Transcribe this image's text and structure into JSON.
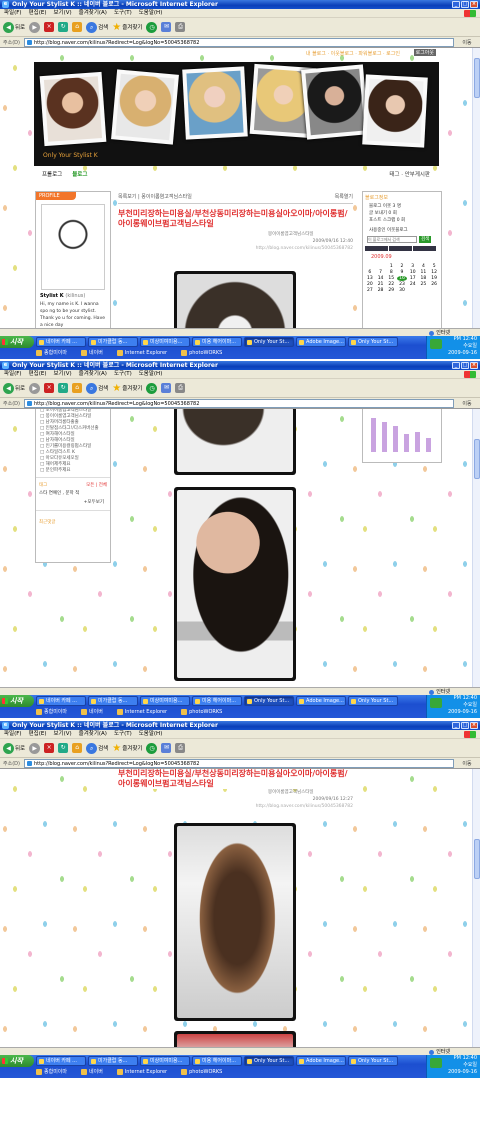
{
  "window": {
    "title": "Only Your Stylist K :: 네이버 블로그 - Microsoft Internet Explorer",
    "menu": [
      "파일(F)",
      "편집(E)",
      "보기(V)",
      "즐겨찾기(A)",
      "도구(T)",
      "도움말(H)"
    ],
    "toolbar": {
      "back": "뒤로",
      "search": "검색",
      "favorites": "즐겨찾기"
    },
    "address_label": "주소(D)",
    "url": "http://blog.naver.com/kilinus?Redirect=Log&logNo=50045368782",
    "go_label": "이동",
    "status_zone": "인터넷"
  },
  "taskbar": {
    "start": "시작",
    "tasks": [
      "네이버 카페 ...",
      "미가클럽 동...",
      "미상미여미용...",
      "미용 헤어이마...",
      "Only Your St...",
      "Adobe Image...",
      "Only Your St..."
    ],
    "quick": [
      "종합미이마",
      "네이버",
      "Internet Explorer",
      "photoWORKS"
    ],
    "clock": {
      "time": "PM 12:40",
      "day": "수요일",
      "date": "2009-09-16"
    }
  },
  "blog": {
    "header_links": "내 블로그 · 이웃블로그 · 파워블로그 · 로그인",
    "header_button": "로그아웃",
    "title": "Only Your Stylist K",
    "nav": [
      "프롤로그",
      "블로그"
    ],
    "nav_right": "태그 · 안부게시판",
    "profile_tab": "PROFILE",
    "profile_name": "Stylist K",
    "profile_id": "(kilinus)",
    "profile_desc": "Hi, my name is K. I wanna spo ng to be your stylist. Thank yo u for coming. Have a nice day",
    "post_list_label": "목록보기 | 몽이이롬염고객님스타일",
    "post_open_label": "목록열기",
    "post_title": "부천미리장하는미용실/부천상동미리장하는미용실아오이마/아이롱펌/아이롱웨이브펌고객님스타일",
    "post_category": "몽이이롬염고객님스타일",
    "post_date": "2009/09/16 12:40",
    "post_url": "http://blog.naver.com/kilinus/50045368782",
    "right_box": {
      "title": "블로그정보",
      "stats": [
        "블로그 이웃 3 명",
        "글 보내기 0 회",
        "포스트 스크랩 0 회"
      ],
      "search_placeholder": "이 블로그에서 검색",
      "search_label": "사용중인 이웃블로그",
      "search_button": "검색",
      "calendar_title": "2009.09",
      "calendar_days": [
        "1",
        "2",
        "3",
        "4",
        "5",
        "6",
        "7",
        "8",
        "9",
        "10",
        "11",
        "12",
        "13",
        "14",
        "15",
        "16",
        "17",
        "18",
        "19",
        "20",
        "21",
        "22",
        "23",
        "24",
        "25",
        "26",
        "27",
        "28",
        "29",
        "30"
      ]
    },
    "categories": [
      "오이이롬염고객님스타일",
      "몽이이롬염고객님스타일",
      "남자머리롱타출출",
      "인탈점스타그!/다스커버선출",
      "여자해어스타일",
      "남자해어스타일",
      "인기롤미용컬링펌스타일",
      "스타일리스트 K",
      "아모다유모세오일",
      "해어제주제요",
      "분인파주제요"
    ],
    "tag_label": "태그",
    "tag_links": "모든 | 전체",
    "tags": "스타 연예인 , 문학 적",
    "tag_more": "+모두보기",
    "recent_label": "최근댓글",
    "post_date2": "2009/09/16 12:27"
  }
}
